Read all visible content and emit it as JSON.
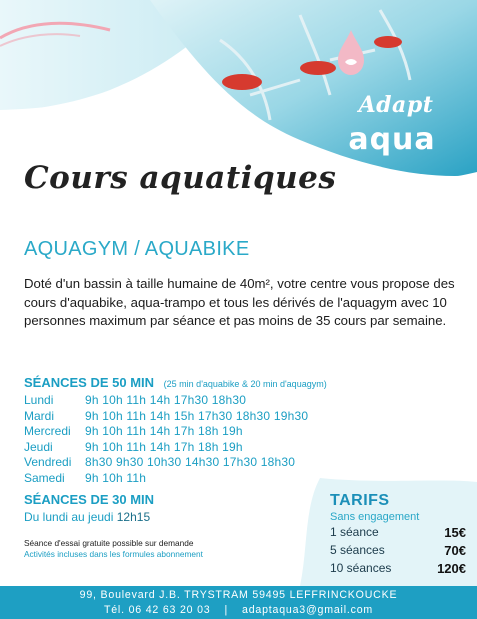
{
  "logo": {
    "line1": "Adapt",
    "line2": "aqua"
  },
  "title": "Cours aquatiques",
  "subtitle": "AQUAGYM / AQUABIKE",
  "intro": "Doté d'un bassin à taille humaine de 40m², votre centre vous propose des cours d'aquabike, aqua-trampo et tous les dérivés de l'aquagym avec 10 personnes maximum par séance et pas moins de 35 cours par semaine.",
  "sessions50": {
    "heading": "SÉANCES DE 50 MIN",
    "note": "(25 min d'aquabike & 20 min d'aquagym)",
    "rows": [
      {
        "day": "Lundi",
        "times": "9h 10h 11h 14h 17h30 18h30"
      },
      {
        "day": "Mardi",
        "times": "9h 10h 11h 14h 15h 17h30 18h30 19h30"
      },
      {
        "day": "Mercredi",
        "times": "9h 10h 11h 14h 17h 18h 19h"
      },
      {
        "day": "Jeudi",
        "times": "9h 10h 11h 14h 17h 18h 19h"
      },
      {
        "day": "Vendredi",
        "times": "8h30 9h30 10h30 14h30 17h30 18h30"
      },
      {
        "day": "Samedi",
        "times": "9h 10h 11h"
      }
    ]
  },
  "sessions30": {
    "heading": "SÉANCES DE 30 MIN",
    "days": "Du lundi au jeudi",
    "time": "12h15"
  },
  "trial": {
    "line1": "Séance d'essai gratuite possible sur demande",
    "line2": "Activités incluses dans les formules abonnement"
  },
  "tarifs": {
    "title": "TARIFS",
    "subtitle": "Sans engagement",
    "rows": [
      {
        "label": "1 séance",
        "price": "15€"
      },
      {
        "label": "5 séances",
        "price": "70€"
      },
      {
        "label": "10 séances",
        "price": "120€"
      }
    ]
  },
  "footer": {
    "address": "99, Boulevard J.B. TRYSTRAM 59495 LEFFRINCKOUCKE",
    "phone": "Tél. 06 42 63 20 03",
    "separator": "|",
    "email": "adaptaqua3@gmail.com"
  },
  "colors": {
    "accent": "#1e9fc3",
    "water": "#bfe6ef",
    "pink": "#f2a7b4"
  }
}
